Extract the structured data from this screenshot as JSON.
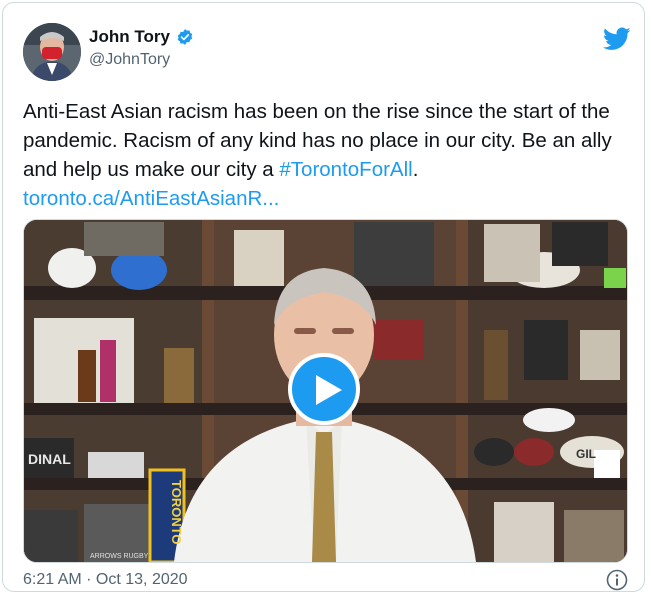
{
  "author": {
    "display_name": "John Tory",
    "handle": "@JohnTory",
    "verified": true,
    "avatar_icon": "person-avatar-with-red-mask"
  },
  "brand_icon": "twitter-bird-icon",
  "tweet": {
    "text_before_hashtag": "Anti-East Asian racism has been on the rise since the start of the pandemic. Racism of any kind has no place in our city. Be an ally and help us make our city a ",
    "hashtag": "#TorontoForAll",
    "text_after_hashtag": ".",
    "link": "toronto.ca/AntiEastAsianR..."
  },
  "media": {
    "type": "video",
    "play_icon": "play-icon",
    "scene_labels": {
      "sign": "DINAL",
      "scarf": "TORONTO",
      "ball": "GIL",
      "banner": "ARROWS RUGBY"
    }
  },
  "footer": {
    "timestamp": "6:21 AM · Oct 13, 2020",
    "info_icon": "info-icon"
  },
  "colors": {
    "accent": "#1d9bf0",
    "text": "#0f1419",
    "secondary": "#536471",
    "border": "#cfd9de"
  }
}
